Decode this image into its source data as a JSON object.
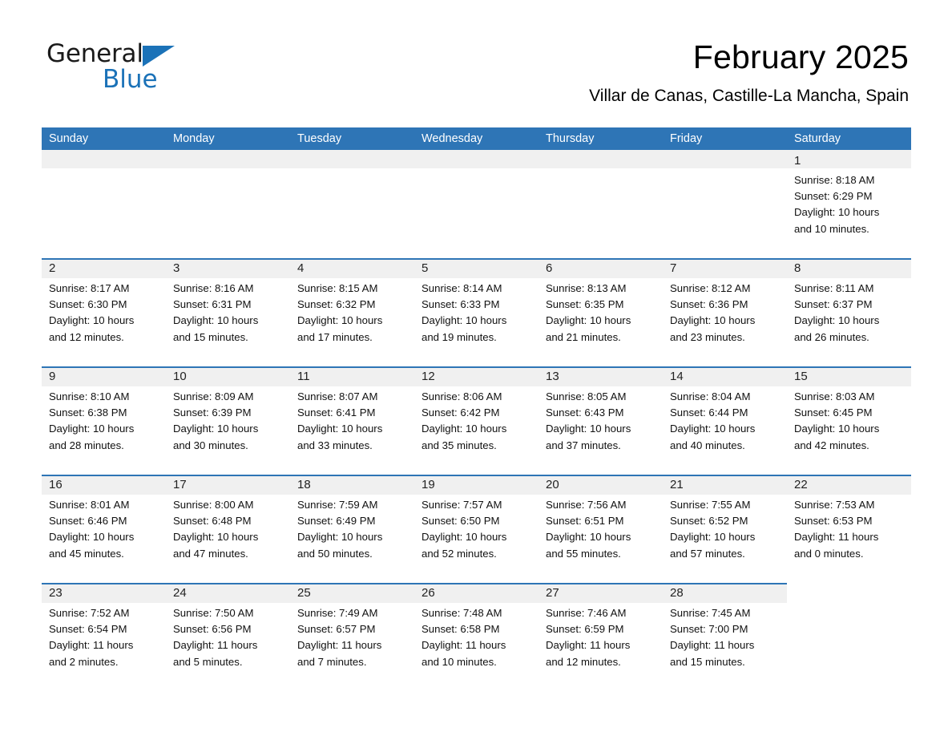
{
  "brand": {
    "word_general": "General",
    "word_blue": "Blue",
    "flag_icon": "triangle-flag-icon"
  },
  "header": {
    "month_title": "February 2025",
    "location": "Villar de Canas, Castille-La Mancha, Spain"
  },
  "colors": {
    "header_blue": "#2e75b6",
    "band_gray": "#f0f0f0",
    "brand_blue": "#1b72b8",
    "text": "#000000"
  },
  "weekdays": [
    "Sunday",
    "Monday",
    "Tuesday",
    "Wednesday",
    "Thursday",
    "Friday",
    "Saturday"
  ],
  "weeks": [
    [
      {
        "day": "",
        "sunrise": "",
        "sunset": "",
        "daylight1": "",
        "daylight2": "",
        "empty": true
      },
      {
        "day": "",
        "sunrise": "",
        "sunset": "",
        "daylight1": "",
        "daylight2": "",
        "empty": true
      },
      {
        "day": "",
        "sunrise": "",
        "sunset": "",
        "daylight1": "",
        "daylight2": "",
        "empty": true
      },
      {
        "day": "",
        "sunrise": "",
        "sunset": "",
        "daylight1": "",
        "daylight2": "",
        "empty": true
      },
      {
        "day": "",
        "sunrise": "",
        "sunset": "",
        "daylight1": "",
        "daylight2": "",
        "empty": true
      },
      {
        "day": "",
        "sunrise": "",
        "sunset": "",
        "daylight1": "",
        "daylight2": "",
        "empty": true
      },
      {
        "day": "1",
        "sunrise": "Sunrise: 8:18 AM",
        "sunset": "Sunset: 6:29 PM",
        "daylight1": "Daylight: 10 hours",
        "daylight2": "and 10 minutes.",
        "empty": false
      }
    ],
    [
      {
        "day": "2",
        "sunrise": "Sunrise: 8:17 AM",
        "sunset": "Sunset: 6:30 PM",
        "daylight1": "Daylight: 10 hours",
        "daylight2": "and 12 minutes.",
        "empty": false
      },
      {
        "day": "3",
        "sunrise": "Sunrise: 8:16 AM",
        "sunset": "Sunset: 6:31 PM",
        "daylight1": "Daylight: 10 hours",
        "daylight2": "and 15 minutes.",
        "empty": false
      },
      {
        "day": "4",
        "sunrise": "Sunrise: 8:15 AM",
        "sunset": "Sunset: 6:32 PM",
        "daylight1": "Daylight: 10 hours",
        "daylight2": "and 17 minutes.",
        "empty": false
      },
      {
        "day": "5",
        "sunrise": "Sunrise: 8:14 AM",
        "sunset": "Sunset: 6:33 PM",
        "daylight1": "Daylight: 10 hours",
        "daylight2": "and 19 minutes.",
        "empty": false
      },
      {
        "day": "6",
        "sunrise": "Sunrise: 8:13 AM",
        "sunset": "Sunset: 6:35 PM",
        "daylight1": "Daylight: 10 hours",
        "daylight2": "and 21 minutes.",
        "empty": false
      },
      {
        "day": "7",
        "sunrise": "Sunrise: 8:12 AM",
        "sunset": "Sunset: 6:36 PM",
        "daylight1": "Daylight: 10 hours",
        "daylight2": "and 23 minutes.",
        "empty": false
      },
      {
        "day": "8",
        "sunrise": "Sunrise: 8:11 AM",
        "sunset": "Sunset: 6:37 PM",
        "daylight1": "Daylight: 10 hours",
        "daylight2": "and 26 minutes.",
        "empty": false
      }
    ],
    [
      {
        "day": "9",
        "sunrise": "Sunrise: 8:10 AM",
        "sunset": "Sunset: 6:38 PM",
        "daylight1": "Daylight: 10 hours",
        "daylight2": "and 28 minutes.",
        "empty": false
      },
      {
        "day": "10",
        "sunrise": "Sunrise: 8:09 AM",
        "sunset": "Sunset: 6:39 PM",
        "daylight1": "Daylight: 10 hours",
        "daylight2": "and 30 minutes.",
        "empty": false
      },
      {
        "day": "11",
        "sunrise": "Sunrise: 8:07 AM",
        "sunset": "Sunset: 6:41 PM",
        "daylight1": "Daylight: 10 hours",
        "daylight2": "and 33 minutes.",
        "empty": false
      },
      {
        "day": "12",
        "sunrise": "Sunrise: 8:06 AM",
        "sunset": "Sunset: 6:42 PM",
        "daylight1": "Daylight: 10 hours",
        "daylight2": "and 35 minutes.",
        "empty": false
      },
      {
        "day": "13",
        "sunrise": "Sunrise: 8:05 AM",
        "sunset": "Sunset: 6:43 PM",
        "daylight1": "Daylight: 10 hours",
        "daylight2": "and 37 minutes.",
        "empty": false
      },
      {
        "day": "14",
        "sunrise": "Sunrise: 8:04 AM",
        "sunset": "Sunset: 6:44 PM",
        "daylight1": "Daylight: 10 hours",
        "daylight2": "and 40 minutes.",
        "empty": false
      },
      {
        "day": "15",
        "sunrise": "Sunrise: 8:03 AM",
        "sunset": "Sunset: 6:45 PM",
        "daylight1": "Daylight: 10 hours",
        "daylight2": "and 42 minutes.",
        "empty": false
      }
    ],
    [
      {
        "day": "16",
        "sunrise": "Sunrise: 8:01 AM",
        "sunset": "Sunset: 6:46 PM",
        "daylight1": "Daylight: 10 hours",
        "daylight2": "and 45 minutes.",
        "empty": false
      },
      {
        "day": "17",
        "sunrise": "Sunrise: 8:00 AM",
        "sunset": "Sunset: 6:48 PM",
        "daylight1": "Daylight: 10 hours",
        "daylight2": "and 47 minutes.",
        "empty": false
      },
      {
        "day": "18",
        "sunrise": "Sunrise: 7:59 AM",
        "sunset": "Sunset: 6:49 PM",
        "daylight1": "Daylight: 10 hours",
        "daylight2": "and 50 minutes.",
        "empty": false
      },
      {
        "day": "19",
        "sunrise": "Sunrise: 7:57 AM",
        "sunset": "Sunset: 6:50 PM",
        "daylight1": "Daylight: 10 hours",
        "daylight2": "and 52 minutes.",
        "empty": false
      },
      {
        "day": "20",
        "sunrise": "Sunrise: 7:56 AM",
        "sunset": "Sunset: 6:51 PM",
        "daylight1": "Daylight: 10 hours",
        "daylight2": "and 55 minutes.",
        "empty": false
      },
      {
        "day": "21",
        "sunrise": "Sunrise: 7:55 AM",
        "sunset": "Sunset: 6:52 PM",
        "daylight1": "Daylight: 10 hours",
        "daylight2": "and 57 minutes.",
        "empty": false
      },
      {
        "day": "22",
        "sunrise": "Sunrise: 7:53 AM",
        "sunset": "Sunset: 6:53 PM",
        "daylight1": "Daylight: 11 hours",
        "daylight2": "and 0 minutes.",
        "empty": false
      }
    ],
    [
      {
        "day": "23",
        "sunrise": "Sunrise: 7:52 AM",
        "sunset": "Sunset: 6:54 PM",
        "daylight1": "Daylight: 11 hours",
        "daylight2": "and 2 minutes.",
        "empty": false
      },
      {
        "day": "24",
        "sunrise": "Sunrise: 7:50 AM",
        "sunset": "Sunset: 6:56 PM",
        "daylight1": "Daylight: 11 hours",
        "daylight2": "and 5 minutes.",
        "empty": false
      },
      {
        "day": "25",
        "sunrise": "Sunrise: 7:49 AM",
        "sunset": "Sunset: 6:57 PM",
        "daylight1": "Daylight: 11 hours",
        "daylight2": "and 7 minutes.",
        "empty": false
      },
      {
        "day": "26",
        "sunrise": "Sunrise: 7:48 AM",
        "sunset": "Sunset: 6:58 PM",
        "daylight1": "Daylight: 11 hours",
        "daylight2": "and 10 minutes.",
        "empty": false
      },
      {
        "day": "27",
        "sunrise": "Sunrise: 7:46 AM",
        "sunset": "Sunset: 6:59 PM",
        "daylight1": "Daylight: 11 hours",
        "daylight2": "and 12 minutes.",
        "empty": false
      },
      {
        "day": "28",
        "sunrise": "Sunrise: 7:45 AM",
        "sunset": "Sunset: 7:00 PM",
        "daylight1": "Daylight: 11 hours",
        "daylight2": "and 15 minutes.",
        "empty": false
      },
      {
        "day": "",
        "sunrise": "",
        "sunset": "",
        "daylight1": "",
        "daylight2": "",
        "empty": true
      }
    ]
  ]
}
